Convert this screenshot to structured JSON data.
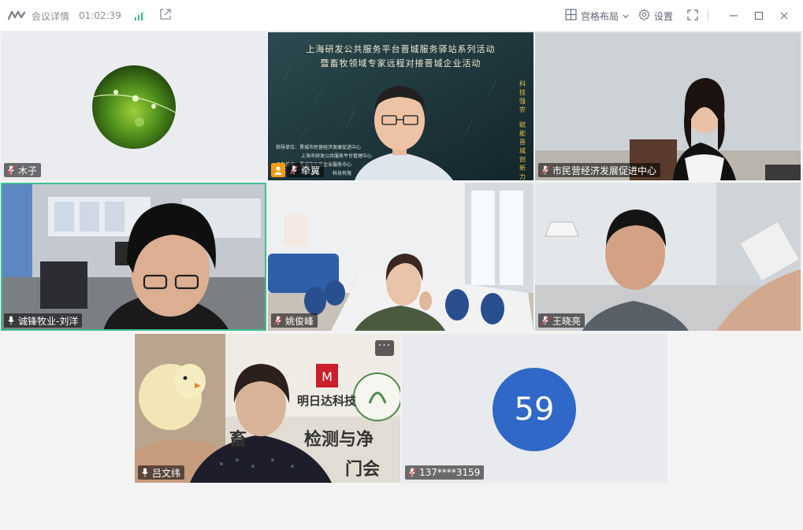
{
  "titlebar": {
    "meeting_details": "会议详情",
    "elapsed": "01:02:39",
    "layout_label": "宫格布局",
    "settings_label": "设置"
  },
  "colors": {
    "accent_active": "#3fbf8f",
    "host_badge": "#f39c12",
    "number_avatar": "#2f68c6",
    "signal_green": "#3bb47e"
  },
  "tiles": [
    {
      "name": "木子",
      "mic": "muted",
      "content": "avatar-image"
    },
    {
      "name": "牵翼",
      "mic": "muted",
      "host": true,
      "content": "video"
    },
    {
      "name": "市民营经济发展促进中心",
      "mic": "muted",
      "content": "video"
    },
    {
      "name": "诚锋牧业-刘洋",
      "mic": "on",
      "active": true,
      "content": "video"
    },
    {
      "name": "姚俊峰",
      "mic": "muted",
      "content": "video"
    },
    {
      "name": "王晓亮",
      "mic": "muted",
      "content": "video"
    },
    {
      "name": "吕文纬",
      "mic": "on",
      "content": "video"
    },
    {
      "name": "137****3159",
      "mic": "muted",
      "content": "number-avatar",
      "avatar_number": "59"
    }
  ],
  "slide": {
    "title_line1": "上海研发公共服务平台晋城服务驿站系列活动",
    "title_line2": "暨畜牧领域专家远程对接晋城企业活动",
    "side_left": "科技强农",
    "side_right": "赋能晋城创新力",
    "footer_line1": "指导单位：晋城市民营经济发展促进中心",
    "footer_line2": "上海市研发公共服务平台管理中心",
    "footer_line3": "承办单位：晋城市民营企业服务中心",
    "footer_line4": "科技有限"
  },
  "poster": {
    "company": "明日达科技",
    "line_a": "畜",
    "line_b": "检测与净",
    "line_c": "门会"
  }
}
